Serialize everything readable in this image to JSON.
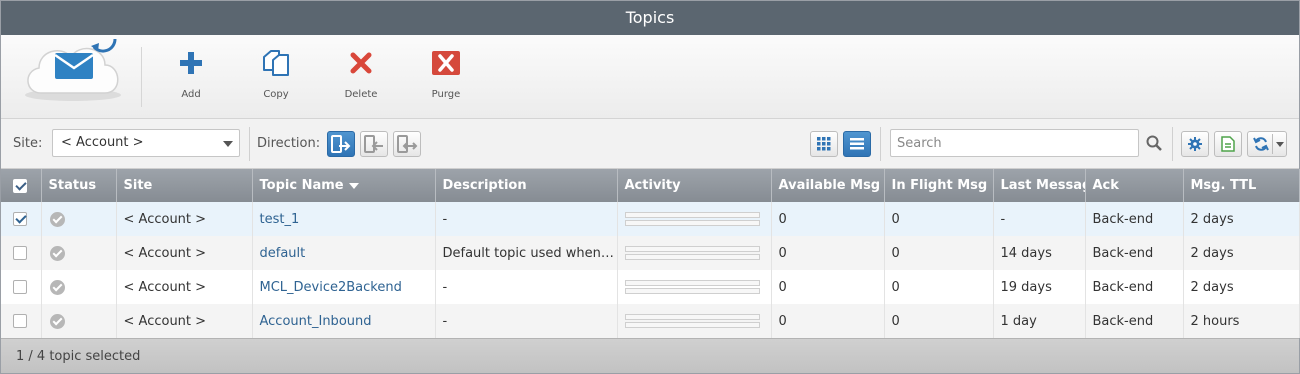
{
  "window": {
    "title": "Topics"
  },
  "toolbar": {
    "add_label": "Add",
    "copy_label": "Copy",
    "delete_label": "Delete",
    "purge_label": "Purge"
  },
  "filters": {
    "site_label": "Site:",
    "site_value": "< Account >",
    "direction_label": "Direction:",
    "search_placeholder": "Search"
  },
  "table": {
    "columns": [
      "Status",
      "Site",
      "Topic Name",
      "Description",
      "Activity",
      "Available Msg",
      "In Flight Msg",
      "Last Message",
      "Ack",
      "Msg. TTL"
    ],
    "rows": [
      {
        "checked": true,
        "site": "< Account >",
        "topic": "test_1",
        "description": "-",
        "available": "0",
        "inflight": "0",
        "last": "-",
        "ack": "Back-end",
        "ttl": "2 days"
      },
      {
        "checked": false,
        "site": "< Account >",
        "topic": "default",
        "description": "Default topic used when n...",
        "available": "0",
        "inflight": "0",
        "last": "14 days",
        "ack": "Back-end",
        "ttl": "2 days"
      },
      {
        "checked": false,
        "site": "< Account >",
        "topic": "MCL_Device2Backend",
        "description": "-",
        "available": "0",
        "inflight": "0",
        "last": "19 days",
        "ack": "Back-end",
        "ttl": "2 days"
      },
      {
        "checked": false,
        "site": "< Account >",
        "topic": "Account_Inbound",
        "description": "-",
        "available": "0",
        "inflight": "0",
        "last": "1 day",
        "ack": "Back-end",
        "ttl": "2 hours"
      }
    ]
  },
  "footer": {
    "status": "1 / 4  topic selected"
  },
  "icons": {
    "logo": "cloud-mail-sync-icon",
    "add": "plus-icon",
    "copy": "copy-icon",
    "delete": "x-icon",
    "purge": "purge-icon",
    "search": "search-icon",
    "settings": "gear-icon",
    "export": "document-icon",
    "refresh": "refresh-icon"
  },
  "colors": {
    "titlebar": "#5b6670",
    "accent_blue": "#2f74b5",
    "delete_red": "#d9473a",
    "purge_red": "#d5493c",
    "link": "#2f6392",
    "export_green": "#4ea34a"
  }
}
